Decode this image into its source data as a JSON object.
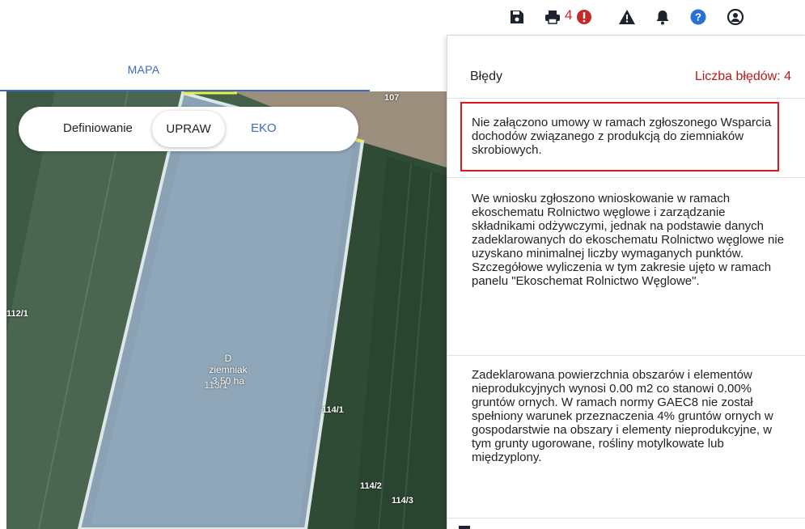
{
  "toolbar": {
    "icons": [
      "save-icon",
      "print-icon",
      "error-icon",
      "warning-icon",
      "bell-icon",
      "help-icon",
      "user-icon"
    ],
    "error_count": "4",
    "colors": {
      "icon": "#1d2430",
      "error": "#c62828",
      "help": "#2a6fd6"
    }
  },
  "tabs": {
    "map_label": "MAPA"
  },
  "toggle": {
    "label": "Definiowanie",
    "option_crops": "UPRAW",
    "option_eco": "EKO"
  },
  "map": {
    "plots": {
      "p107": "107",
      "p112_1": "112/1",
      "p114_1": "114/1",
      "p114_2": "114/2",
      "p114_3": "114/3",
      "p113_1": "113/1"
    },
    "parcel": {
      "code": "D",
      "crop": "ziemniak",
      "area": "3.50 ha"
    }
  },
  "errors_panel": {
    "title": "Błędy",
    "count_label": "Liczba błędów: 4",
    "items": [
      {
        "text": "Nie załączono umowy w ramach zgłoszonego Wsparcia dochodów związanego z produkcją do ziemniaków skrobiowych."
      },
      {
        "text": "We wniosku zgłoszono wnioskowanie w ramach ekoschematu Rolnictwo węglowe i zarządzanie składnikami odżywczymi, jednak na podstawie danych zadeklarowanych do ekoschematu Rolnictwo węglowe nie uzyskano minimalnej liczby wymaganych punktów. Szczegółowe wyliczenia w tym zakresie ujęto w ramach panelu \"Ekoschemat Rolnictwo Węglowe\"."
      },
      {
        "text": "Zadeklarowana powierzchnia obszarów i elementów nieprodukcyjnych wynosi 0.00 m2 co stanowi 0.00% gruntów ornych. W ramach normy GAEC8 nie został spełniony warunek przeznaczenia 4% gruntów ornych w gospodarstwie na obszary i elementy nieprodukcyjne, w tym grunty ugorowane, rośliny motylkowate lub międzyplony."
      }
    ],
    "colors": {
      "count": "#b71c1c",
      "highlight_border": "#e0141e"
    }
  }
}
